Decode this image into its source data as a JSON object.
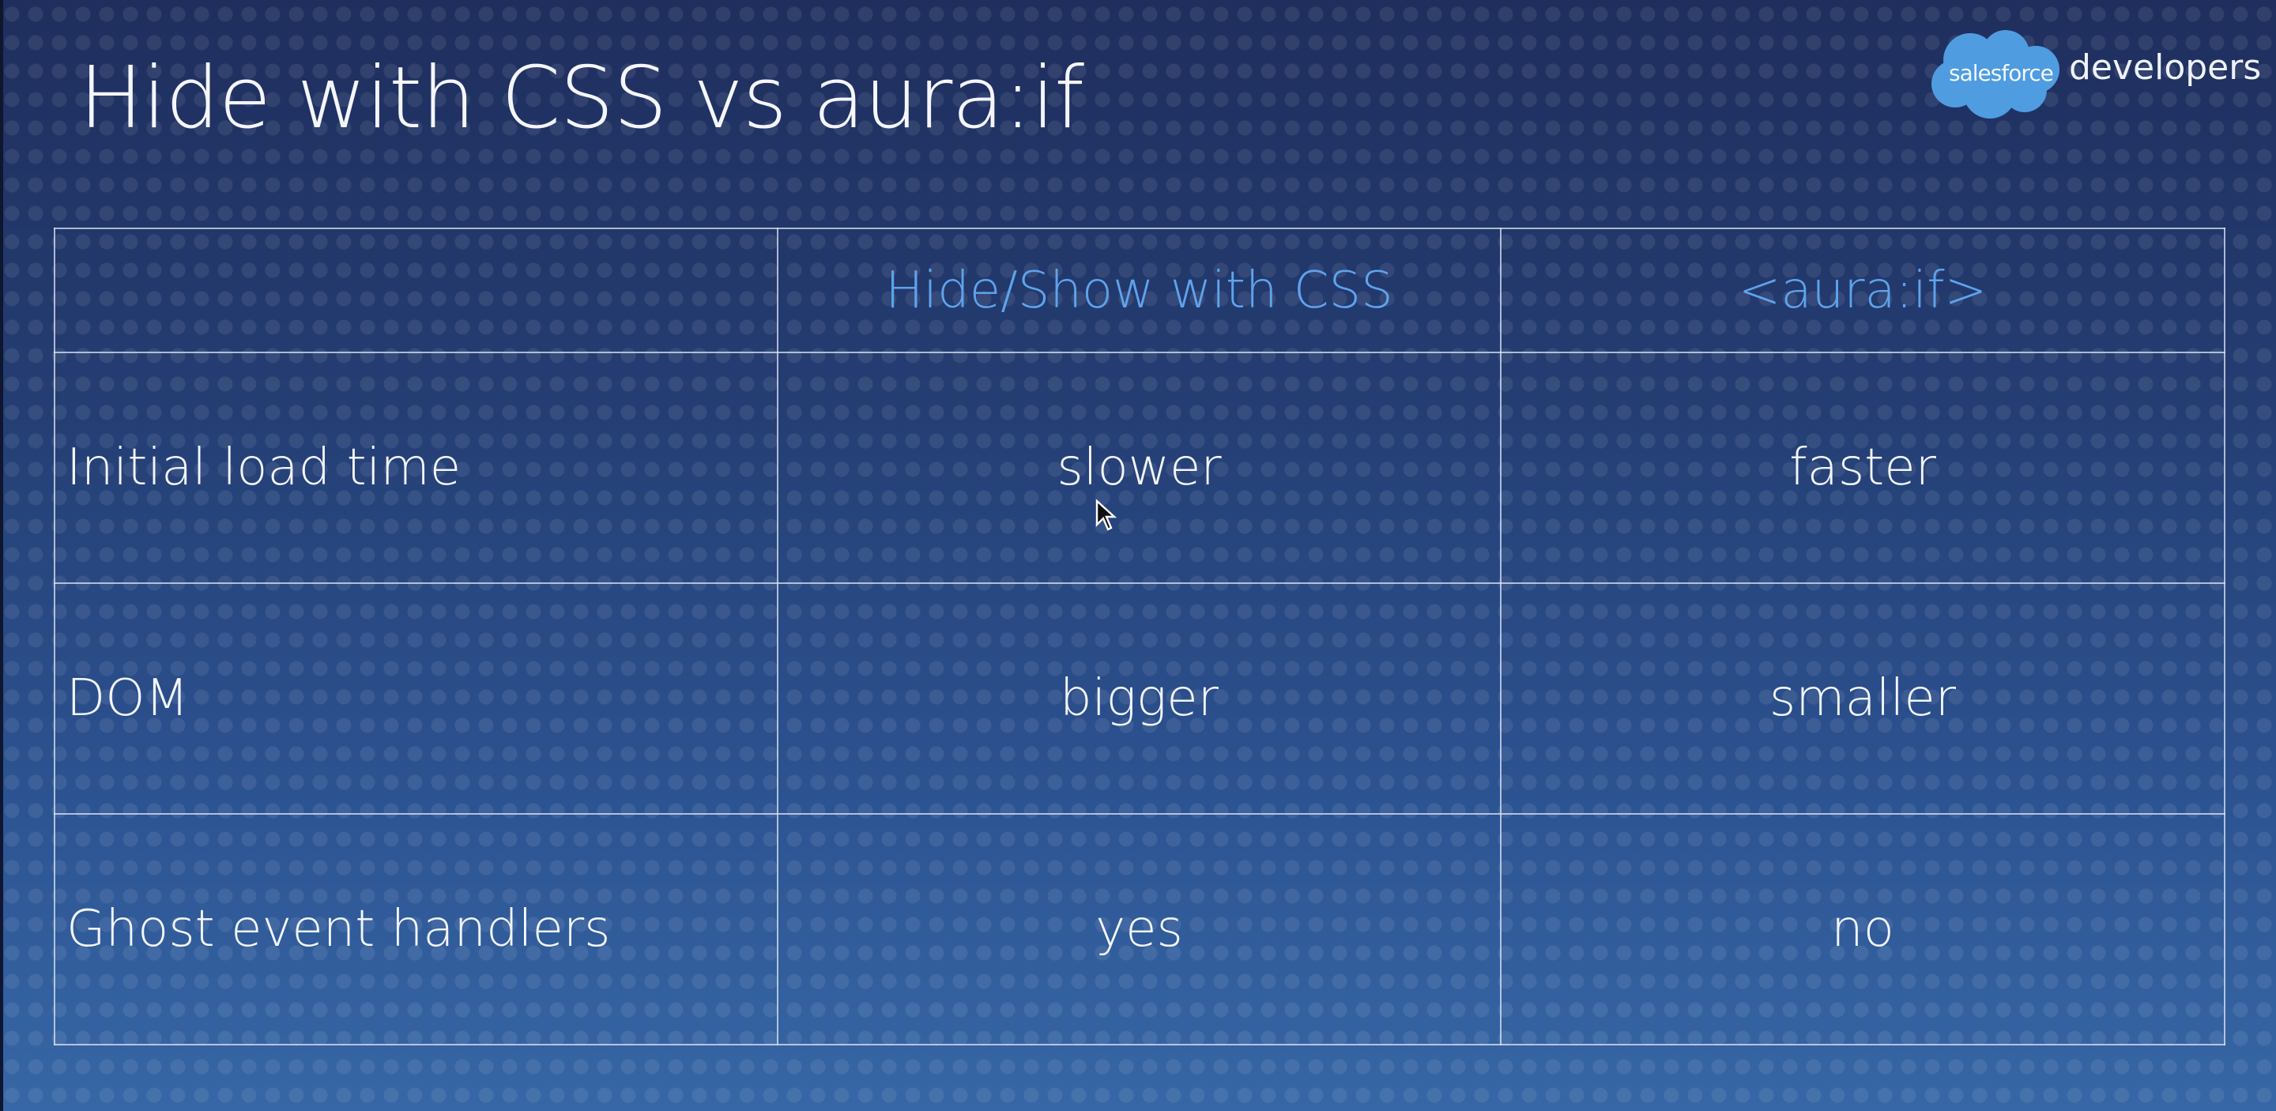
{
  "slide": {
    "title": "Hide with CSS vs aura:if",
    "logo": {
      "brand": "salesforce",
      "suffix": "developers"
    }
  },
  "table": {
    "headers": [
      "",
      "Hide/Show with CSS",
      "<aura:if>"
    ],
    "rows": [
      {
        "label": "Initial load time",
        "css": "slower",
        "aura_if": "faster"
      },
      {
        "label": "DOM",
        "css": "bigger",
        "aura_if": "smaller"
      },
      {
        "label": "Ghost event handlers",
        "css": "yes",
        "aura_if": "no"
      }
    ]
  },
  "colors": {
    "header_text": "#5fa3ec",
    "logo_cloud": "#4f9ce0",
    "background_top": "#1f2e5d",
    "background_bottom": "#3767a6"
  }
}
